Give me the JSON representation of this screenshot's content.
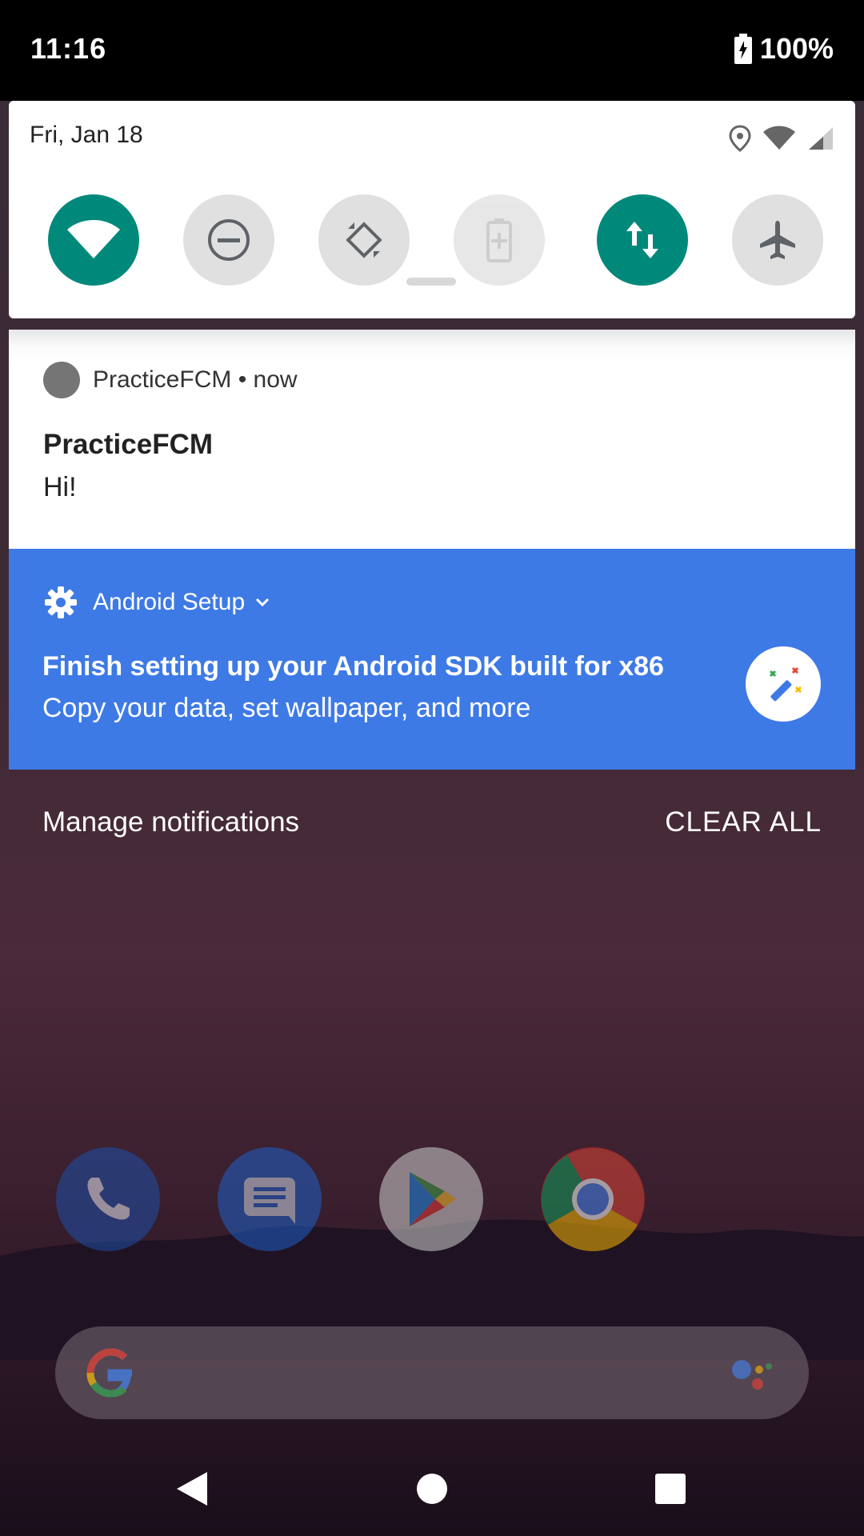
{
  "status_bar": {
    "time": "11:16",
    "battery": "100%"
  },
  "quick_settings": {
    "date": "Fri, Jan 18",
    "tiles": [
      {
        "name": "wifi",
        "icon": "wifi-icon",
        "state": "on"
      },
      {
        "name": "do-not-disturb",
        "icon": "dnd-icon",
        "state": "off"
      },
      {
        "name": "auto-rotate",
        "icon": "rotate-icon",
        "state": "off"
      },
      {
        "name": "battery-saver",
        "icon": "battery-saver-icon",
        "state": "disabled"
      },
      {
        "name": "mobile-data",
        "icon": "data-arrows-icon",
        "state": "on"
      },
      {
        "name": "airplane-mode",
        "icon": "airplane-icon",
        "state": "off"
      }
    ],
    "accent": "#00897b"
  },
  "notifications": {
    "fcm": {
      "app": "PracticeFCM",
      "time": "now",
      "title": "PracticeFCM",
      "text": "Hi!"
    },
    "setup": {
      "app": "Android Setup",
      "title": "Finish setting up your Android SDK built for x86",
      "text": "Copy your data, set wallpaper, and more",
      "color": "#3e7ae5"
    }
  },
  "footer": {
    "manage": "Manage notifications",
    "clear_all": "CLEAR ALL"
  },
  "dock": {
    "apps": [
      {
        "name": "phone",
        "icon": "phone-icon"
      },
      {
        "name": "messages",
        "icon": "messages-icon"
      },
      {
        "name": "play-store",
        "icon": "play-store-icon"
      },
      {
        "name": "chrome",
        "icon": "chrome-icon"
      }
    ]
  }
}
